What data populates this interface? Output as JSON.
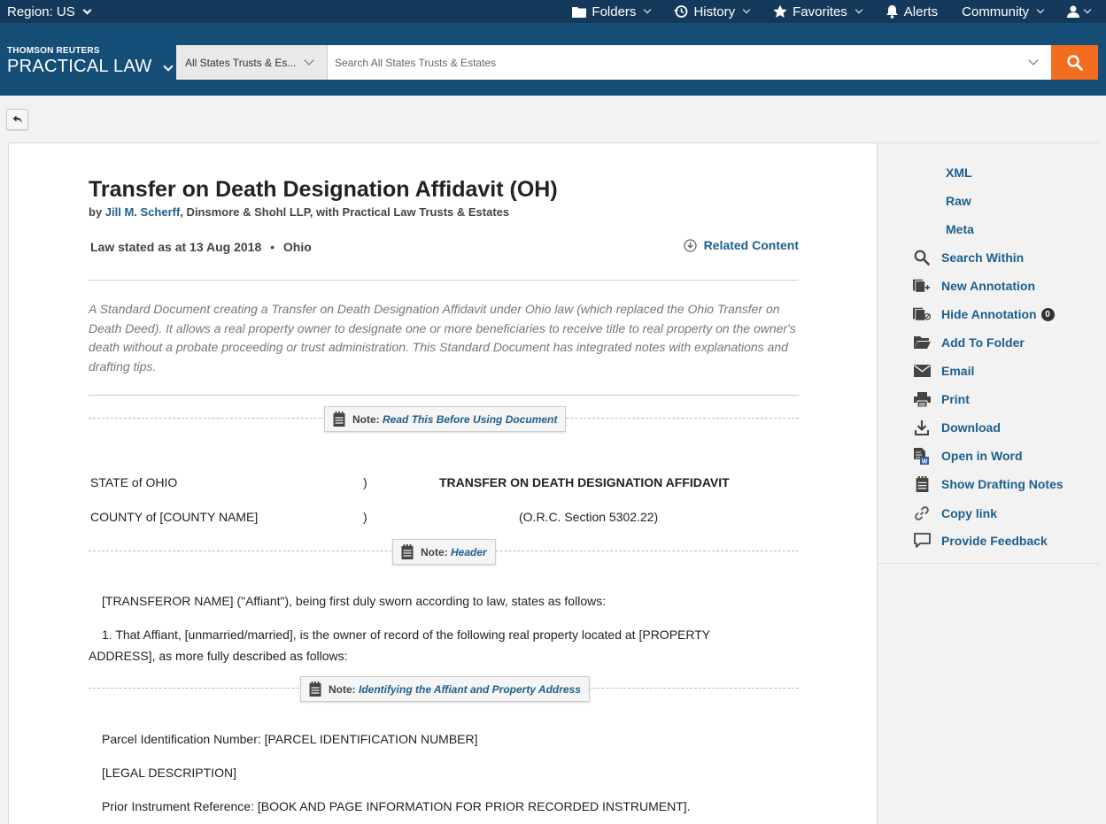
{
  "topbar": {
    "region_label": "Region: US",
    "nav": [
      {
        "label": "Folders",
        "icon": "folder-icon",
        "dropdown": true
      },
      {
        "label": "History",
        "icon": "history-icon",
        "dropdown": true
      },
      {
        "label": "Favorites",
        "icon": "star-icon",
        "dropdown": true
      },
      {
        "label": "Alerts",
        "icon": "bell-icon",
        "dropdown": false
      },
      {
        "label": "Community",
        "icon": "",
        "dropdown": true
      }
    ],
    "user_icon": "user-icon"
  },
  "header": {
    "brand_top": "THOMSON REUTERS",
    "brand_main": "PRACTICAL LAW",
    "scope_select": "All States Trusts & Es...",
    "search_placeholder": "Search All States Trusts & Estates",
    "search_button_icon": "search-icon"
  },
  "document": {
    "title": "Transfer on Death Designation Affidavit (OH)",
    "byline_prefix": "by ",
    "author": "Jill M. Scherff",
    "byline_suffix": ", Dinsmore & Shohl LLP, with Practical Law Trusts & Estates",
    "law_stated": "Law stated as at 13 Aug 2018",
    "separator": "•",
    "jurisdiction": "Ohio",
    "related_content": "Related Content",
    "abstract": "A Standard Document creating a Transfer on Death Designation Affidavit under Ohio law (which replaced the Ohio Transfer on Death Deed). It allows a real property owner to designate one or more beneficiaries to receive title to real property on the owner's death without a probate proceeding or trust administration. This Standard Document has integrated notes with explanations and drafting tips.",
    "notes": [
      {
        "label": "Note:",
        "link": "Read This Before Using Document"
      },
      {
        "label": "Note:",
        "link": "Header"
      },
      {
        "label": "Note:",
        "link": "Identifying the Affiant and Property Address"
      }
    ],
    "caption": {
      "state": "STATE of OHIO",
      "county": "COUNTY of [COUNTY NAME]",
      "paren1": ")",
      "paren2": ")",
      "heading": "TRANSFER ON DEATH DESIGNATION AFFIDAVIT",
      "section": "(O.R.C. Section 5302.22)"
    },
    "para_intro": "[TRANSFEROR NAME] (\"Affiant\"), being first duly sworn according to law, states as follows:",
    "para1_line1": "1. That Affiant, [unmarried/married], is the owner of record of the following real property located at [PROPERTY",
    "para1_line2": "ADDRESS], as more fully described as follows:",
    "parcel": "Parcel Identification Number: [PARCEL IDENTIFICATION NUMBER]",
    "legal": "[LEGAL DESCRIPTION]",
    "prior": "Prior Instrument Reference: [BOOK AND PAGE INFORMATION FOR PRIOR RECORDED INSTRUMENT]."
  },
  "sidebar": {
    "tools": [
      {
        "label": "XML",
        "icon": ""
      },
      {
        "label": "Raw",
        "icon": ""
      },
      {
        "label": "Meta",
        "icon": ""
      },
      {
        "label": "Search Within",
        "icon": "search-icon"
      },
      {
        "label": "New Annotation",
        "icon": "new-annotation-icon"
      },
      {
        "label": "Hide Annotation",
        "icon": "hide-annotation-icon",
        "badge": "0"
      },
      {
        "label": "Add To Folder",
        "icon": "folder-icon"
      },
      {
        "label": "Email",
        "icon": "email-icon"
      },
      {
        "label": "Print",
        "icon": "print-icon"
      },
      {
        "label": "Download",
        "icon": "download-icon"
      },
      {
        "label": "Open in Word",
        "icon": "word-icon"
      },
      {
        "label": "Show Drafting Notes",
        "icon": "notepad-icon"
      },
      {
        "label": "Copy link",
        "icon": "link-icon"
      },
      {
        "label": "Provide Feedback",
        "icon": "feedback-icon"
      }
    ]
  },
  "colors": {
    "topbar": "#15395b",
    "header": "#154f78",
    "accent": "#f36d21",
    "link": "#1d5f8d"
  }
}
